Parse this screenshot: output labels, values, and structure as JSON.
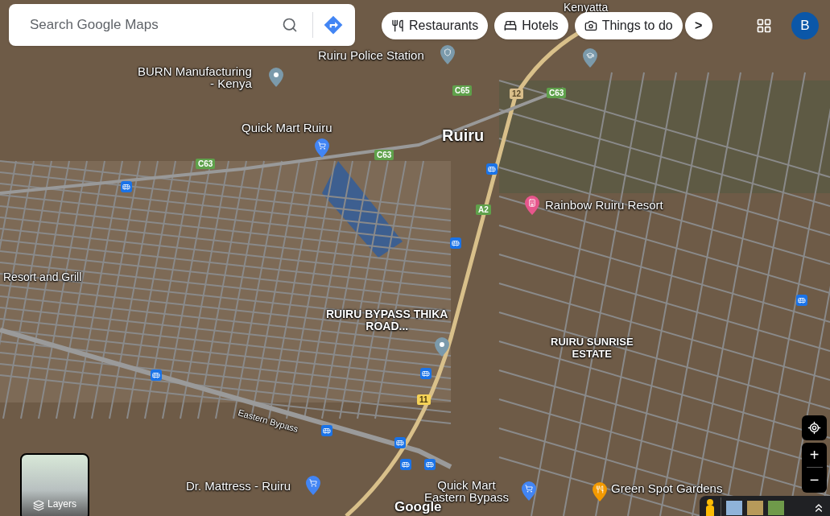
{
  "search": {
    "placeholder": "Search Google Maps"
  },
  "chips": [
    {
      "label": "Restaurants",
      "kind": "restaurants"
    },
    {
      "label": "Hotels",
      "kind": "hotels"
    },
    {
      "label": "Things to do",
      "kind": "things"
    }
  ],
  "more_chips": ">",
  "account": {
    "initial": "B"
  },
  "map": {
    "labels": [
      {
        "kind": "area",
        "lines": [
          "Kenyatta"
        ]
      },
      {
        "kind": "police",
        "lines": [
          "Ruiru Police Station"
        ]
      },
      {
        "kind": "school"
      },
      {
        "kind": "landmark",
        "lines": [
          "BURN Manufacturing",
          "- Kenya"
        ]
      },
      {
        "kind": "shopping",
        "lines": [
          "Quick Mart Ruiru"
        ]
      },
      {
        "kind": "city",
        "lines": [
          "Ruiru"
        ]
      },
      {
        "kind": "lodging",
        "lines": [
          "Rainbow Ruiru Resort"
        ]
      },
      {
        "kind": "area",
        "lines": [
          "Resort and Grill"
        ]
      },
      {
        "kind": "landmark",
        "lines": [
          "RUIRU BYPASS THIKA",
          "ROAD..."
        ]
      },
      {
        "kind": "area",
        "lines": [
          "RUIRU SUNRISE",
          "ESTATE"
        ]
      },
      {
        "kind": "road",
        "lines": [
          "Eastern Bypass"
        ]
      },
      {
        "kind": "shopping",
        "lines": [
          "Dr. Mattress - Ruiru"
        ]
      },
      {
        "kind": "shopping",
        "lines": [
          "Quick Mart",
          "Eastern Bypass"
        ]
      },
      {
        "kind": "dining",
        "lines": [
          "Green Spot Gardens"
        ]
      }
    ],
    "shields": [
      {
        "text": "C65",
        "kind": "county"
      },
      {
        "text": "12",
        "kind": "national"
      },
      {
        "text": "C63",
        "kind": "county"
      },
      {
        "text": "C63",
        "kind": "county"
      },
      {
        "text": "C63",
        "kind": "county"
      },
      {
        "text": "A2",
        "kind": "county"
      },
      {
        "text": "11",
        "kind": "highway"
      }
    ]
  },
  "layers": {
    "label": "Layers"
  },
  "zoom": {
    "in": "+",
    "out": "−"
  },
  "logo": "Google"
}
